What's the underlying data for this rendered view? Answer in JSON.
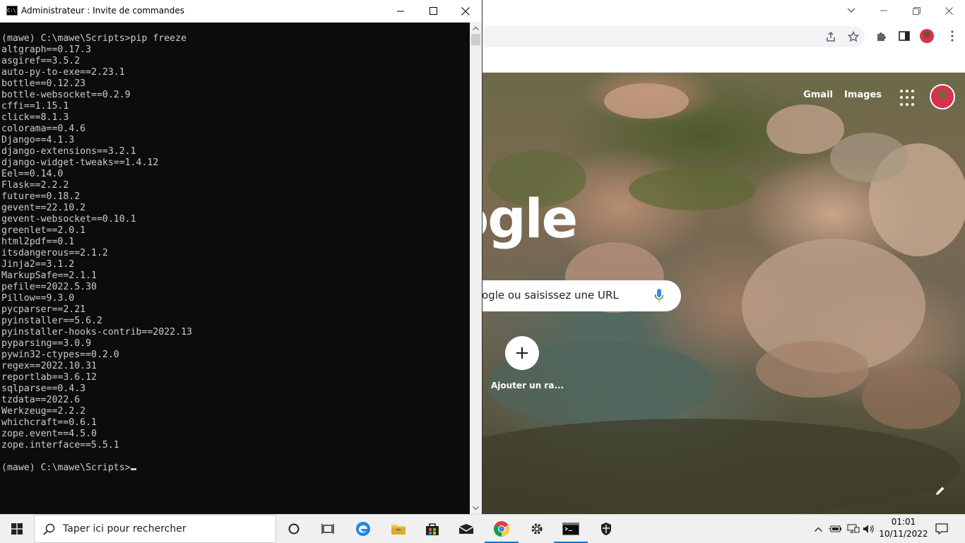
{
  "cmd_window": {
    "title": "Administrateur : Invite de commandes",
    "icon": "cmd-icon",
    "lines": [
      "(mawe) C:\\mawe\\Scripts>pip freeze",
      "altgraph==0.17.3",
      "asgiref==3.5.2",
      "auto-py-to-exe==2.23.1",
      "bottle==0.12.23",
      "bottle-websocket==0.2.9",
      "cffi==1.15.1",
      "click==8.1.3",
      "colorama==0.4.6",
      "Django==4.1.3",
      "django-extensions==3.2.1",
      "django-widget-tweaks==1.4.12",
      "Eel==0.14.0",
      "Flask==2.2.2",
      "future==0.18.2",
      "gevent==22.10.2",
      "gevent-websocket==0.10.1",
      "greenlet==2.0.1",
      "html2pdf==0.1",
      "itsdangerous==2.1.2",
      "Jinja2==3.1.2",
      "MarkupSafe==2.1.1",
      "pefile==2022.5.30",
      "Pillow==9.3.0",
      "pycparser==2.21",
      "pyinstaller==5.6.2",
      "pyinstaller-hooks-contrib==2022.13",
      "pyparsing==3.0.9",
      "pywin32-ctypes==0.2.0",
      "regex==2022.10.31",
      "reportlab==3.6.12",
      "sqlparse==0.4.3",
      "tzdata==2022.6",
      "Werkzeug==2.2.2",
      "whichcraft==0.6.1",
      "zope.event==4.5.0",
      "zope.interface==5.5.1",
      "",
      "(mawe) C:\\mawe\\Scripts>"
    ],
    "colors": {
      "background": "#0c0c0c",
      "text": "#cccccc"
    }
  },
  "chrome": {
    "ntp_links": {
      "gmail": "Gmail",
      "images": "Images"
    },
    "logo_text": "ogle",
    "search_placeholder": "ogle ou saisissez une URL",
    "shortcut_add_label": "Ajouter un ra...",
    "shortcut_add_glyph": "+"
  },
  "taskbar": {
    "search_placeholder": "Taper ici pour rechercher",
    "time": "01:01",
    "date": "10/11/2022",
    "apps": [
      "cortana-icon",
      "task-view-icon",
      "edge-icon",
      "file-explorer-icon",
      "store-icon",
      "mail-icon",
      "chrome-icon",
      "settings-icon",
      "terminal-icon",
      "security-icon"
    ]
  }
}
